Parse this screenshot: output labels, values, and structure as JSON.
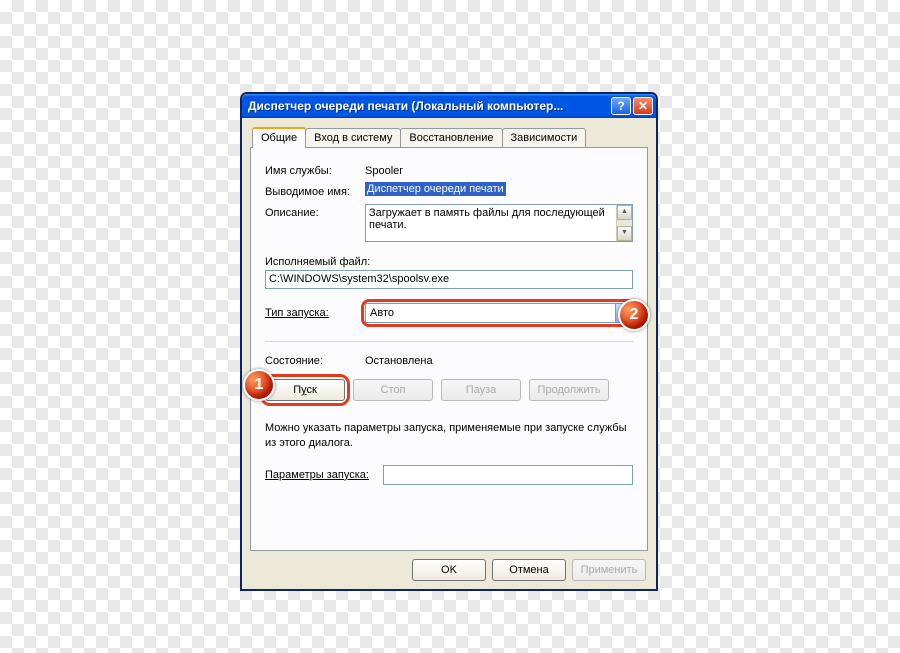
{
  "titlebar": {
    "title": "Диспетчер очереди печати (Локальный компьютер...",
    "help_glyph": "?",
    "close_glyph": "✕"
  },
  "tabs": {
    "general": "Общие",
    "logon": "Вход в систему",
    "recovery": "Восстановление",
    "deps": "Зависимости"
  },
  "labels": {
    "service_name": "Имя службы:",
    "display_name": "Выводимое имя:",
    "description": "Описание:",
    "exe_path": "Исполняемый файл:",
    "startup_type_pre": "Т",
    "startup_type_rest": "ип запуска:",
    "status": "Состояние:",
    "hint": "Можно указать параметры запуска, применяемые при запуске службы из этого диалога.",
    "params_pre": "Пара",
    "params_key": "м",
    "params_rest": "етры запуска:"
  },
  "values": {
    "service_name": "Spooler",
    "display_name": "Диспетчер очереди печати",
    "description": "Загружает в память файлы для последующей печати.",
    "exe_path": "C:\\WINDOWS\\system32\\spoolsv.exe",
    "startup_type": "Авто",
    "status": "Остановлена",
    "params": ""
  },
  "buttons": {
    "start_pre": "П",
    "start_key": "у",
    "start_rest": "ск",
    "stop": "Стоп",
    "pause": "Пауза",
    "resume": "Продолжить",
    "ok": "OK",
    "cancel": "Отмена",
    "apply": "Применить"
  },
  "callouts": {
    "one": "1",
    "two": "2"
  },
  "scroll": {
    "up": "▲",
    "down": "▼"
  },
  "combo_arrow": "▼"
}
